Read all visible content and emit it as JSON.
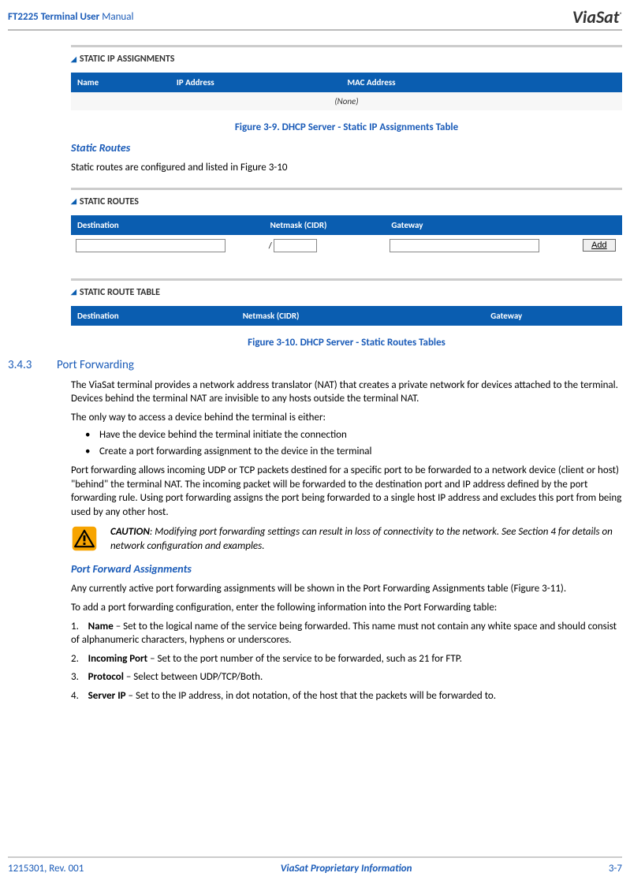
{
  "header": {
    "doc_title_bold": "FT2225 Terminal User",
    "doc_title_normal": " Manual",
    "logo_text": "ViaSat",
    "logo_sub": "®"
  },
  "static_ip_panel": {
    "title": "STATIC IP ASSIGNMENTS",
    "columns": {
      "c1": "Name",
      "c2": "IP Address",
      "c3": "MAC Address"
    },
    "none_text": "(None)",
    "caption": "Figure 3-9. DHCP Server - Static IP Assignments Table"
  },
  "static_routes_intro": {
    "heading": "Static Routes",
    "text": "Static routes are configured and listed in Figure 3-10"
  },
  "static_routes_panel": {
    "title": "STATIC ROUTES",
    "columns": {
      "c1": "Destination",
      "c2": "Netmask (CIDR)",
      "c3": "Gateway"
    },
    "slash": "/",
    "add_label": "Add"
  },
  "static_route_table_panel": {
    "title": "STATIC ROUTE TABLE",
    "columns": {
      "c1": "Destination",
      "c2": "Netmask (CIDR)",
      "c3": "Gateway"
    },
    "caption": "Figure 3-10. DHCP Server - Static Routes Tables"
  },
  "port_forward_section": {
    "number": "3.4.3",
    "title": "Port Forwarding",
    "p1": "The ViaSat terminal provides a network address translator (NAT) that creates a private network for devices attached to the terminal. Devices behind the terminal NAT are invisible to any hosts outside the terminal NAT.",
    "p2": "The only way to access a device behind the terminal is either:",
    "b1": "Have the device behind the terminal initiate the connection",
    "b2": "Create a port forwarding assignment to the device in the terminal",
    "p3": "Port forwarding allows incoming UDP or TCP packets destined for a specific port to be forwarded to a network device (client or host) \"behind\" the terminal NAT. The incoming packet will be forwarded to the destination port and IP address defined by the port forwarding rule. Using port forwarding assigns the port being forwarded to a single host IP address and excludes this port from being used by any other host.",
    "caution_label": "CAUTION",
    "caution_text": ": Modifying port forwarding settings can result in loss of connectivity to the network. See Section 4 for details on network configuration and examples."
  },
  "port_forward_assignments": {
    "heading": "Port Forward Assignments",
    "p1": "Any currently active port forwarding assignments will be shown in the Port Forwarding Assignments table (Figure 3-11).",
    "p2": "To add a port forwarding configuration, enter the following information into the Port Forwarding table:",
    "i1_n": "1.",
    "i1_b": "Name",
    "i1_t": " – Set to the logical name of the service being forwarded.  This name must not contain any white space and should consist of alphanumeric characters, hyphens or underscores.",
    "i2_n": "2.",
    "i2_b": "Incoming Port",
    "i2_t": " – Set to the port number of the service to be forwarded, such as 21 for FTP.",
    "i3_n": "3.",
    "i3_b": "Protocol",
    "i3_t": " – Select between UDP/TCP/Both.",
    "i4_n": "4.",
    "i4_b": "Server IP",
    "i4_t": " – Set to the IP address, in dot notation, of the host that the packets will be forwarded to."
  },
  "footer": {
    "left": "1215301, Rev.  001",
    "center": "ViaSat Proprietary Information",
    "right": "3-7"
  }
}
